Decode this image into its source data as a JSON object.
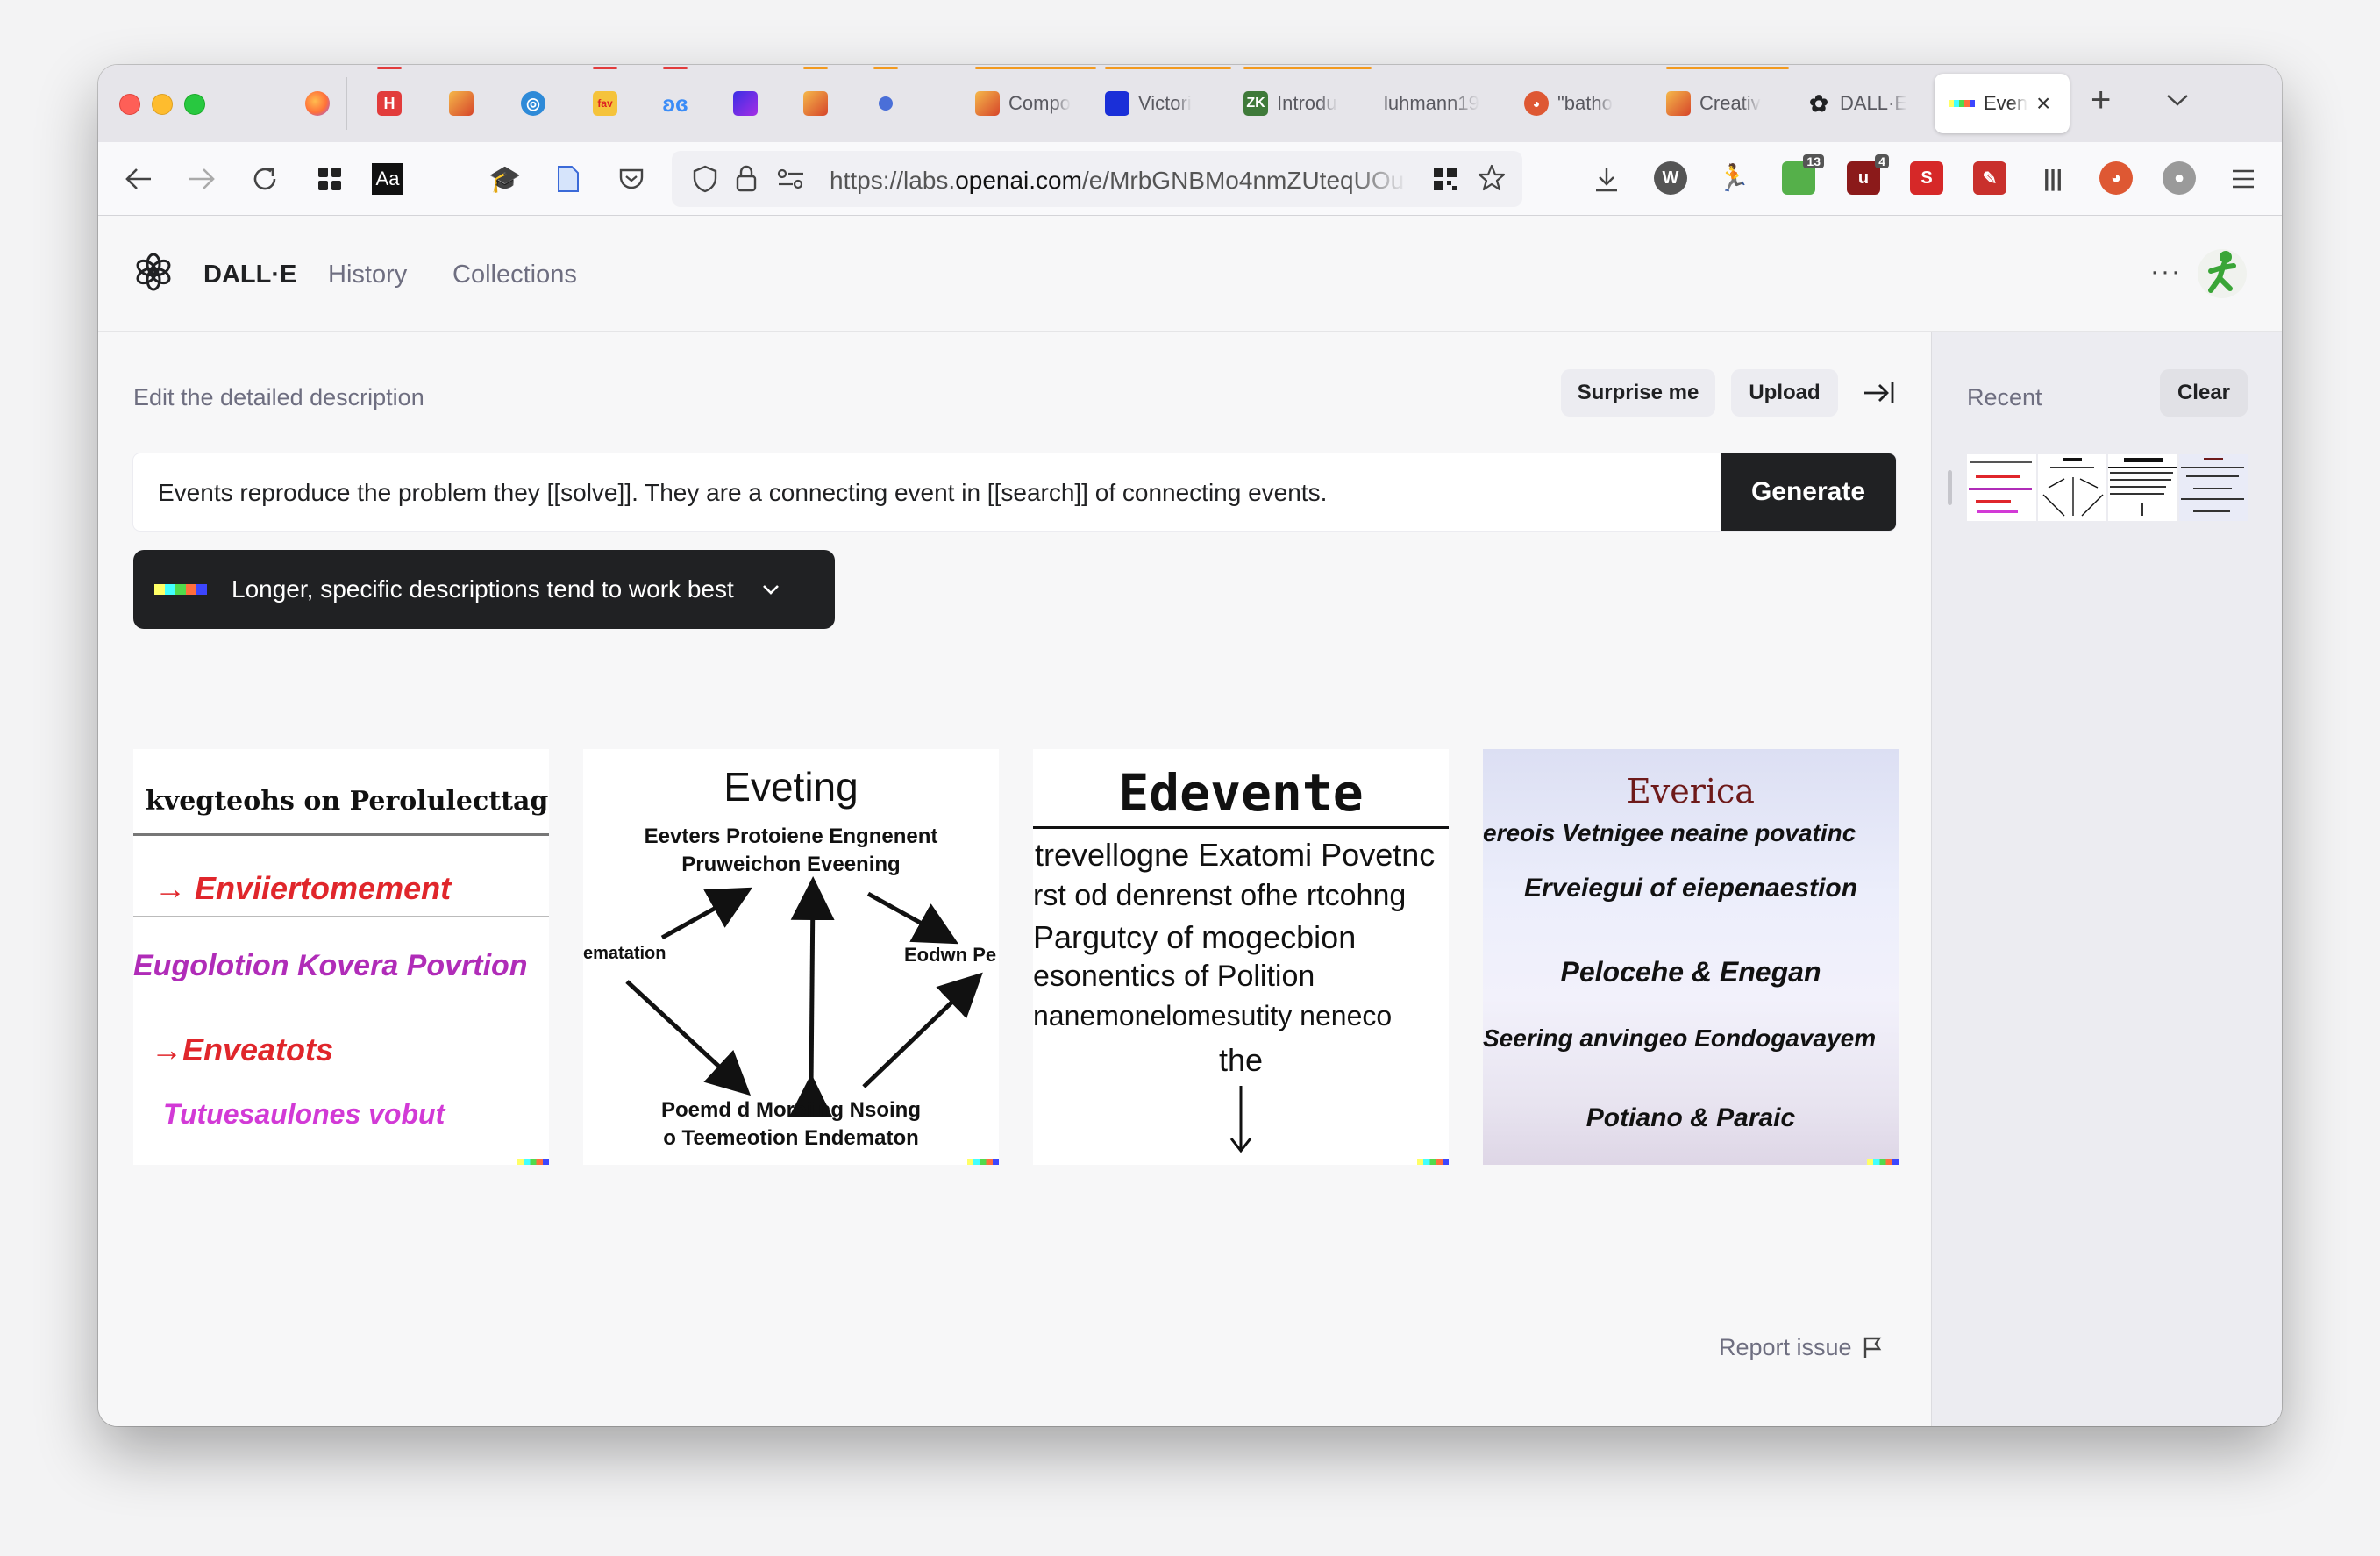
{
  "browser": {
    "tabs": [
      {
        "title": "",
        "favicon": "firefox-icon",
        "color": "#ff7139"
      },
      {
        "title": "",
        "favicon": "h-icon",
        "color": "#e23c3c"
      },
      {
        "title": "",
        "favicon": "gradient-square-icon",
        "color": "#e2712c"
      },
      {
        "title": "",
        "favicon": "globe-icon",
        "color": "#2e8ad8"
      },
      {
        "title": "",
        "favicon": "fan-icon",
        "color": "#e6392a"
      },
      {
        "title": "",
        "favicon": "butterfly-icon",
        "color": "#3b8cf7"
      },
      {
        "title": "",
        "favicon": "purple-square-icon",
        "color": "#6d2ee5"
      },
      {
        "title": "",
        "favicon": "gradient-square-icon",
        "color": "#e28a2c"
      },
      {
        "title": "",
        "favicon": "dot-icon",
        "color": "#4a6fd8"
      },
      {
        "title": "Compo",
        "favicon": "gradient-square-icon",
        "color": "#f29a1f"
      },
      {
        "title": "Victori",
        "favicon": "blue-square-icon",
        "color": "#1a2fd8"
      },
      {
        "title": "Introdu",
        "favicon": "zk-icon",
        "color": "#3f7a3a"
      },
      {
        "title": "luhmann19",
        "favicon": "",
        "color": ""
      },
      {
        "title": "\"batho",
        "favicon": "duckduckgo-icon",
        "color": "#de5833"
      },
      {
        "title": "Creativ",
        "favicon": "gradient-square-icon",
        "color": "#f29a1f"
      },
      {
        "title": "DALL·E",
        "favicon": "openai-icon",
        "color": "#202123"
      }
    ],
    "active_tab": {
      "title": "Even"
    },
    "url_prefix": "https://labs.",
    "url_domain": "openai.com",
    "url_path": "/e/MrbGNBMo4nmZUteqUOu",
    "badges": {
      "ext_a": "13",
      "ext_b": "4"
    },
    "toolbar_text": {
      "reader": "Aa"
    }
  },
  "app": {
    "brand": "DALL·E",
    "nav": [
      "History",
      "Collections"
    ],
    "more": "···"
  },
  "editor": {
    "caption": "Edit the detailed description",
    "surprise_label": "Surprise me",
    "upload_label": "Upload",
    "prompt": "Events reproduce the problem they [[solve]]. They are a connecting event in [[search]] of connecting events.",
    "generate_label": "Generate",
    "tip": "Longer, specific descriptions tend to work best"
  },
  "images": [
    {
      "lines": [
        "kvegteohs on Perolulecttags",
        "→ Enviiertomement",
        "Eugolotion Kovera Povrtion",
        "→Enveatots",
        "Tutuesaulones vobut"
      ]
    },
    {
      "lines": [
        "Eveting",
        "Eevters Protoiene Engnenent",
        "Pruweichon Eveening",
        "ematation",
        "Eodwn Pe",
        "Poemd d Moreiing Nsoing",
        "o Teemeotion Endematon"
      ]
    },
    {
      "lines": [
        "Edevente",
        "trevellogne Exatomi Povetnc",
        "rst od denrenst ofhe rtcohng",
        "Pargutcy of mogecbion",
        "esonentics of Polition",
        "nanemonelomesutity neneco",
        "the"
      ]
    },
    {
      "lines": [
        "Everica",
        "ereois Vetnigee neaine povatinc",
        "Erveiegui of eiepenaestion",
        "Pelocehe & Enegan",
        "Seering anvingeo Eondogavayem",
        "Potiano & Paraic"
      ]
    }
  ],
  "footer": {
    "report": "Report issue"
  },
  "sidebar": {
    "title": "Recent",
    "clear_label": "Clear"
  },
  "colors": {
    "accent": "#202123",
    "muted": "#6e6e80",
    "red_text": "#e0262b",
    "magenta_text": "#b02cb8"
  }
}
